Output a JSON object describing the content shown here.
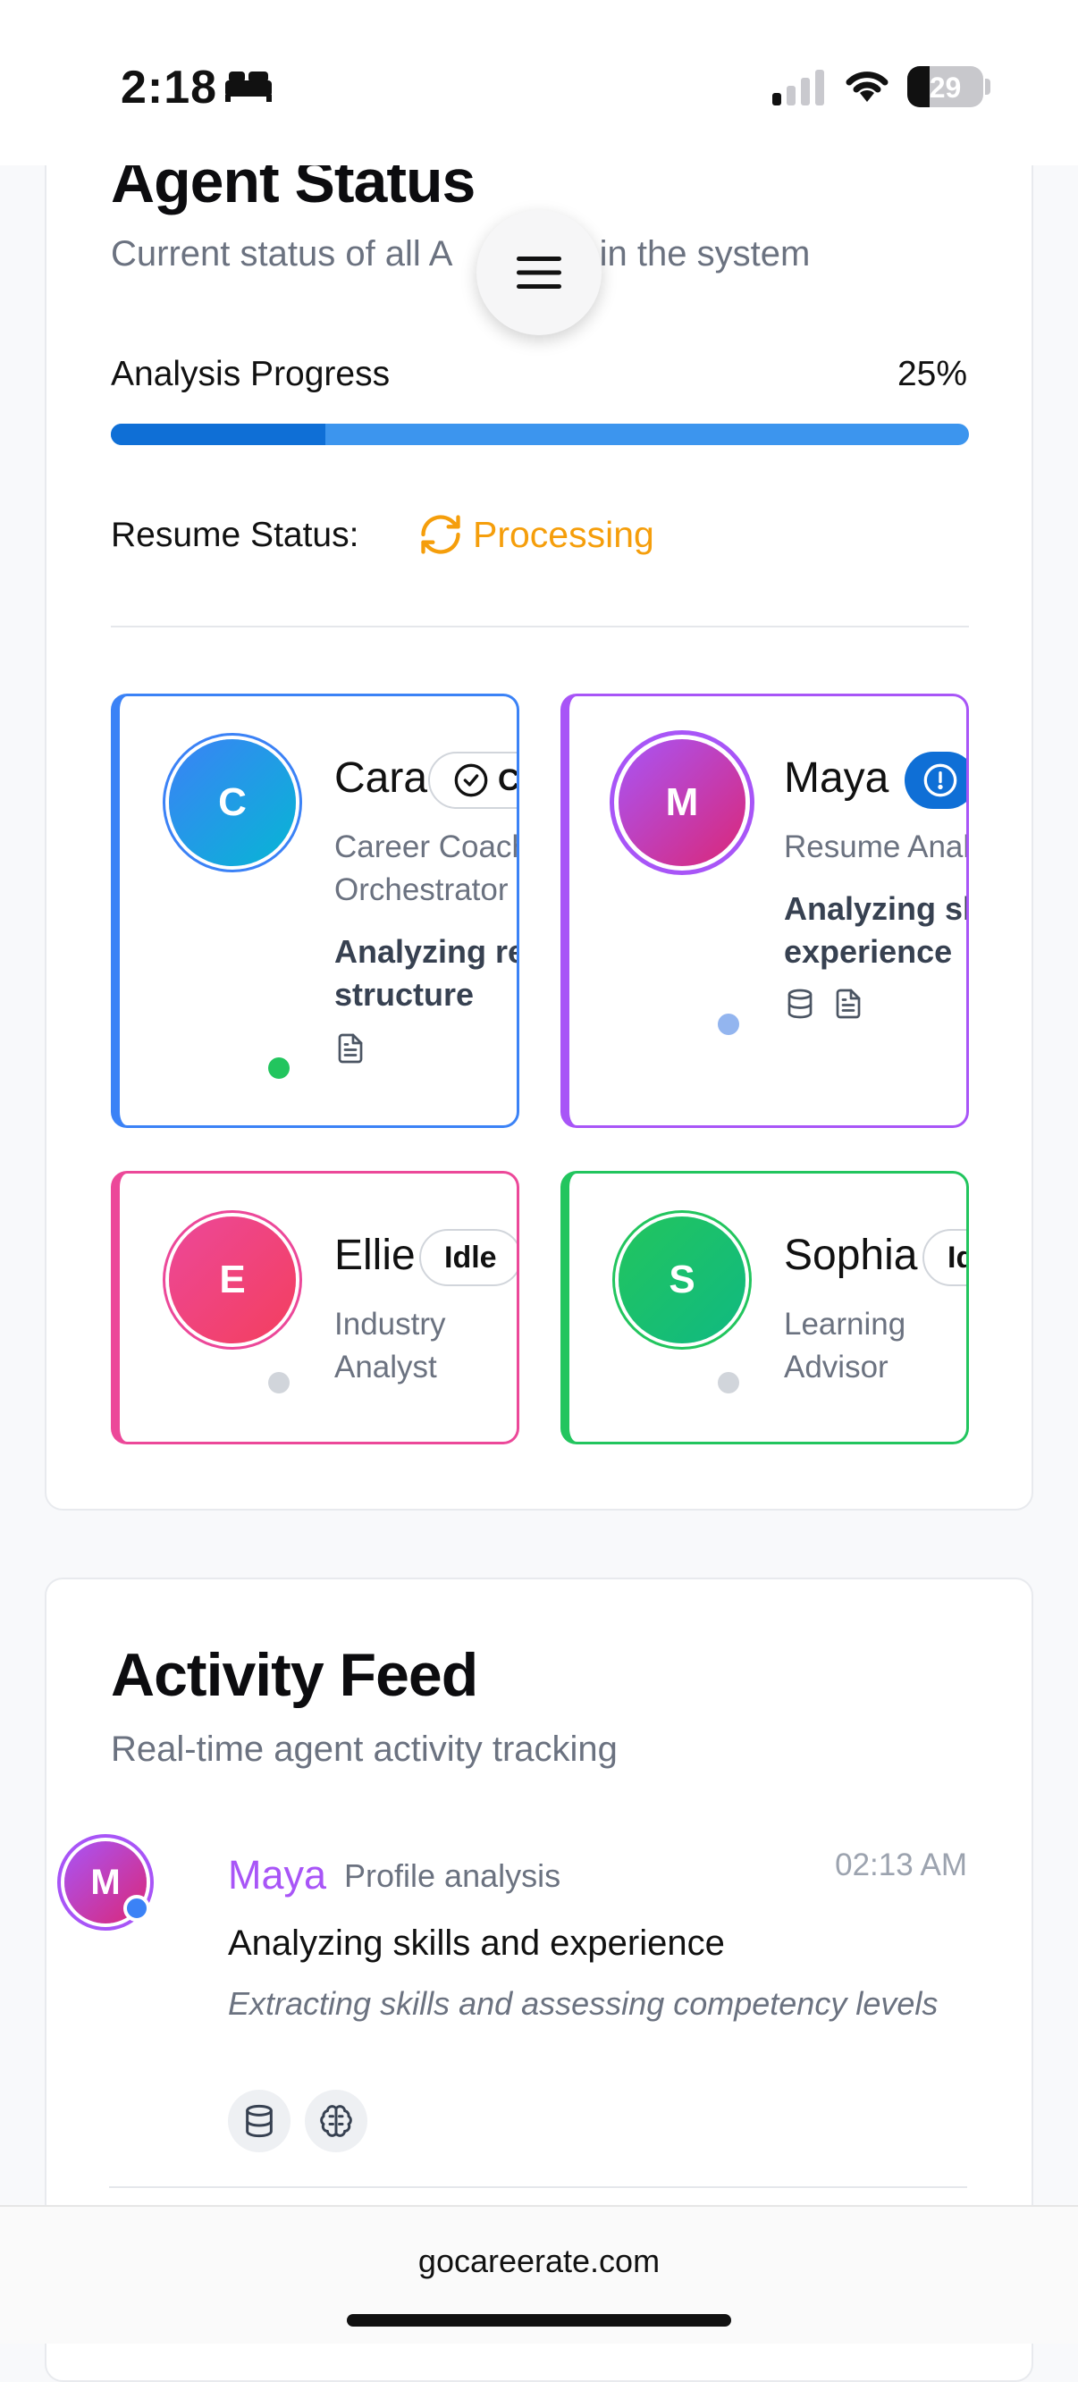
{
  "status_bar": {
    "time": "2:18",
    "battery": "29"
  },
  "menu_icon": "hamburger-menu-icon",
  "agent_status": {
    "title": "Agent Status",
    "subtitle": "Current status of all AI agents in the system",
    "subtitle_visible_left": "Current status of all A",
    "subtitle_visible_right": "ts in the system",
    "progress_label": "Analysis Progress",
    "progress_value": "25%",
    "progress_fraction": 0.25,
    "resume_label": "Resume Status:",
    "resume_status": "Processing",
    "agents": [
      {
        "initial": "C",
        "name": "Cara",
        "role_line1": "Career Coach",
        "role_line2": "Orchestrator",
        "task_line1": "Analyzing resume",
        "task_line2": "structure",
        "status_badge": "C",
        "status_color": "#22c55e",
        "accent": "#3b82f6",
        "icons": [
          "document-icon"
        ]
      },
      {
        "initial": "M",
        "name": "Maya",
        "role_line1": "Resume Analyzer",
        "task_line1": "Analyzing skills",
        "task_line2": "experience",
        "status_color": "#93b5ef",
        "accent": "#a855f7",
        "icons": [
          "database-icon",
          "document-icon"
        ]
      },
      {
        "initial": "E",
        "name": "Ellie",
        "role_line1": "Industry",
        "role_line2": "Analyst",
        "status_badge": "Idle",
        "status_color": "#d1d5db",
        "accent": "#ec4899"
      },
      {
        "initial": "S",
        "name": "Sophia",
        "role_line1": "Learning",
        "role_line2": "Advisor",
        "status_badge": "Id",
        "status_color": "#d1d5db",
        "accent": "#22c55e"
      }
    ]
  },
  "activity_feed": {
    "title": "Activity Feed",
    "subtitle": "Real-time agent activity tracking",
    "items": [
      {
        "initial": "M",
        "agent": "Maya",
        "type": "Profile analysis",
        "time": "02:13 AM",
        "title": "Analyzing skills and experience",
        "description": "Extracting skills and assessing competency levels",
        "icons": [
          "database-icon",
          "brain-icon"
        ]
      }
    ]
  },
  "browser": {
    "url": "gocareerate.com"
  }
}
